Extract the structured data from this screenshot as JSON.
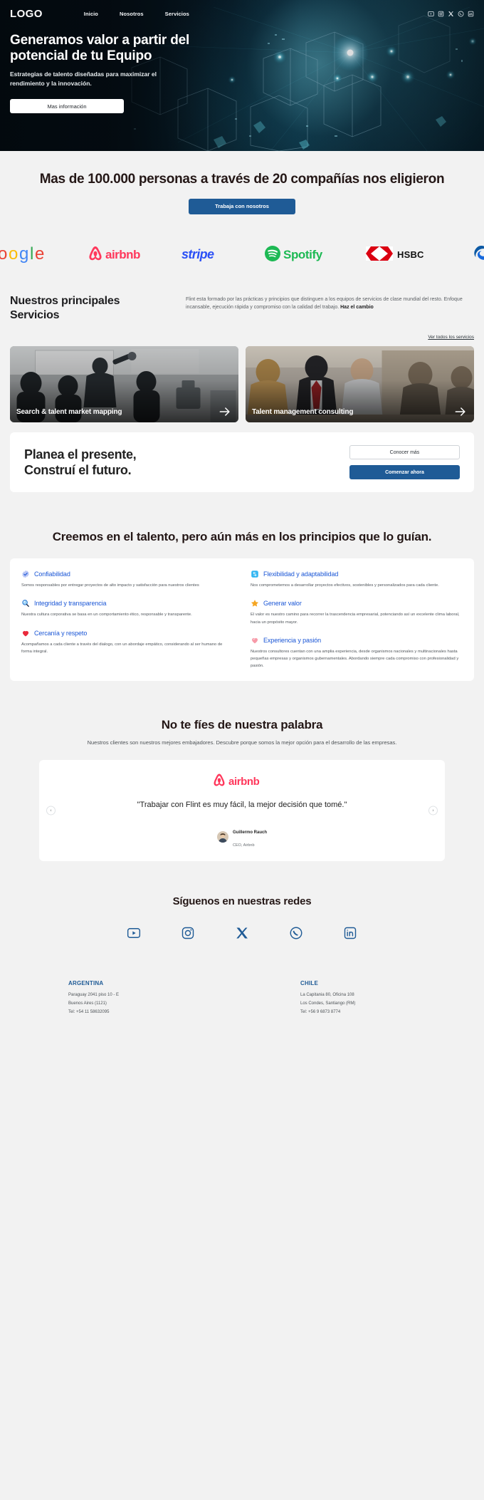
{
  "nav": {
    "logo": "LOGO",
    "links": [
      {
        "label": "Inicio"
      },
      {
        "label": "Nosotros"
      },
      {
        "label": "Servicios"
      }
    ],
    "social": [
      {
        "name": "youtube-icon"
      },
      {
        "name": "instagram-icon"
      },
      {
        "name": "x-twitter-icon"
      },
      {
        "name": "whatsapp-icon"
      },
      {
        "name": "linkedin-icon"
      }
    ]
  },
  "hero": {
    "title": "Generamos valor a partir del potencial de tu Equipo",
    "subtitle": "Estrategias de talento diseñadas para maximizar el rendimiento y la innovación.",
    "button": "Mas información"
  },
  "stats": {
    "headline": "Mas de 100.000 personas a través de 20 compañías nos eligieron",
    "button": "Trabaja con nosotros"
  },
  "logos": [
    {
      "name": "google-logo",
      "text": "Google"
    },
    {
      "name": "airbnb-logo",
      "text": "airbnb"
    },
    {
      "name": "stripe-logo",
      "text": "stripe"
    },
    {
      "name": "spotify-logo",
      "text": "Spotify"
    },
    {
      "name": "hsbc-logo",
      "text": "HSBC"
    },
    {
      "name": "edge-logo",
      "text": ""
    }
  ],
  "services": {
    "title": "Nuestros principales Servicios",
    "description": "Flint esta formado por las prácticas y principios que distinguen a los equipos de servicios de clase mundial del resto. Enfoque incansable, ejecución rápida y compromiso con la calidad del trabajo. ",
    "description_bold": "Haz el cambio",
    "all_link": "Ver todos los servicios",
    "cards": [
      {
        "title": "Search & talent market mapping"
      },
      {
        "title": "Talent management consulting"
      }
    ]
  },
  "cta": {
    "title_line1": "Planea el presente,",
    "title_line2": "Construí el futuro.",
    "secondary_button": "Conocer más",
    "primary_button": "Comenzar ahora"
  },
  "principles": {
    "headline": "Creemos en el talento, pero aún más en los principios que lo guían.",
    "left": [
      {
        "icon": "verified-badge-icon",
        "title": "Confiabilidad",
        "body": "Somos responsables por entregar proyectos de alto  impacto y satisfacción para nuestros clientes"
      },
      {
        "icon": "magnifier-icon",
        "title": "Integridad y transparencia",
        "body": "Nuestra cultura corporativa se basa en un comportamiento ético, responsable y transparente."
      },
      {
        "icon": "heart-icon",
        "title": "Cercanía y respeto",
        "body": "Acompañamos a cada cliente a través del dialogo, con un abordaje empático, considerando al ser humano de forma integral."
      }
    ],
    "right": [
      {
        "icon": "arrows-flexibility-icon",
        "title": "Flexibilidad y adaptabilidad",
        "body": "Nos comprometemos a desarrollar proyectos efectivos, sostenibles y personalizados para cada cliente."
      },
      {
        "icon": "star-icon",
        "title": "Generar valor",
        "body": "El valor es nuestro camino para recorrer la trascendencia empresarial, potenciando así un excelente clima laboral, hacia un propósito mayor."
      },
      {
        "icon": "passion-icon",
        "title": "Experiencia y pasión",
        "body": "Nuestros consultores cuentan con una amplia experiencia, desde organismos nacionales y multinacionales hasta pequeñas empresas y organismos gubernamentales. Abordando siempre cada compromiso con profesionalidad y pasión."
      }
    ]
  },
  "testimonials": {
    "headline": "No te fíes de nuestra palabra",
    "subtitle": "Nuestros clientes son nuestros mejores embajadores. Descubre porque somos la mejor opción para el desarrollo de las empresas.",
    "brand": "airbnb",
    "quote": "\"Trabajar con Flint es muy fácil, la mejor decisión que tomé.\"",
    "author_name": "Guillermo Rauch",
    "author_role": "CEO, Airbnb",
    "prev": "‹",
    "next": "›"
  },
  "social_section": {
    "headline": "Síguenos en nuestras redes",
    "icons": [
      {
        "name": "youtube-icon"
      },
      {
        "name": "instagram-icon"
      },
      {
        "name": "x-twitter-icon"
      },
      {
        "name": "whatsapp-icon"
      },
      {
        "name": "linkedin-icon"
      }
    ]
  },
  "footer": {
    "offices": [
      {
        "country": "ARGENTINA",
        "address1": "Paraguay 2041 piso 10 - E",
        "address2": "Buenos Aires (1121)",
        "phone": "Tel: +54 11 58632095"
      },
      {
        "country": "CHILE",
        "address1": "La Capitania 80, Oficina 108",
        "address2": "Los Condes, Santiango (RM)",
        "phone": "Tel: +56 9 6873 8774"
      }
    ]
  },
  "colors": {
    "accent_blue": "#1f5b96",
    "principle_blue": "#1a56d6",
    "hero_dark": "#050d14",
    "page_bg": "#f2f2f2"
  }
}
